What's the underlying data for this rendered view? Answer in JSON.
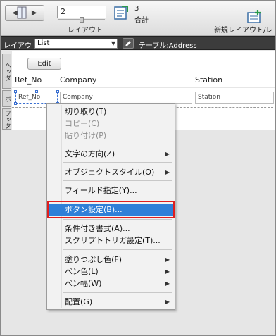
{
  "toolbar": {
    "record_number": "2",
    "layout_label": "レイアウト",
    "total_count": "3",
    "total_label": "合計",
    "new_layout_label": "新規レイアウト/レ"
  },
  "layout_bar": {
    "label": "レイアウト:",
    "layout_name": "List",
    "table_label": "テーブル:Address"
  },
  "parts": {
    "header": "ヘッダ",
    "body": "ボ",
    "footer": "フッタ"
  },
  "header": {
    "edit_button": "Edit",
    "columns": [
      "Ref_No",
      "Company",
      "Station"
    ]
  },
  "body": {
    "fields": [
      "Ref_No",
      "Company",
      "Station"
    ]
  },
  "context_menu": {
    "items": [
      {
        "label": "切り取り(T)",
        "enabled": true,
        "submenu": false
      },
      {
        "label": "コピー(C)",
        "enabled": false,
        "submenu": false
      },
      {
        "label": "貼り付け(P)",
        "enabled": false,
        "submenu": false
      },
      {
        "label": "文字の方向(Z)",
        "enabled": true,
        "submenu": true
      },
      {
        "label": "オブジェクトスタイル(O)",
        "enabled": true,
        "submenu": true
      },
      {
        "label": "フィールド指定(Y)...",
        "enabled": true,
        "submenu": false
      },
      {
        "label": "ボタン設定(B)...",
        "enabled": true,
        "submenu": false,
        "highlighted": true
      },
      {
        "label": "条件付き書式(A)...",
        "enabled": true,
        "submenu": false
      },
      {
        "label": "スクリプトトリガ設定(T)...",
        "enabled": true,
        "submenu": false
      },
      {
        "label": "塗りつぶし色(F)",
        "enabled": true,
        "submenu": true
      },
      {
        "label": "ペン色(L)",
        "enabled": true,
        "submenu": true
      },
      {
        "label": "ペン幅(W)",
        "enabled": true,
        "submenu": true
      },
      {
        "label": "配置(G)",
        "enabled": true,
        "submenu": true
      }
    ]
  },
  "colors": {
    "highlight": "#2f7fd8",
    "annotation": "#e01e1e"
  }
}
